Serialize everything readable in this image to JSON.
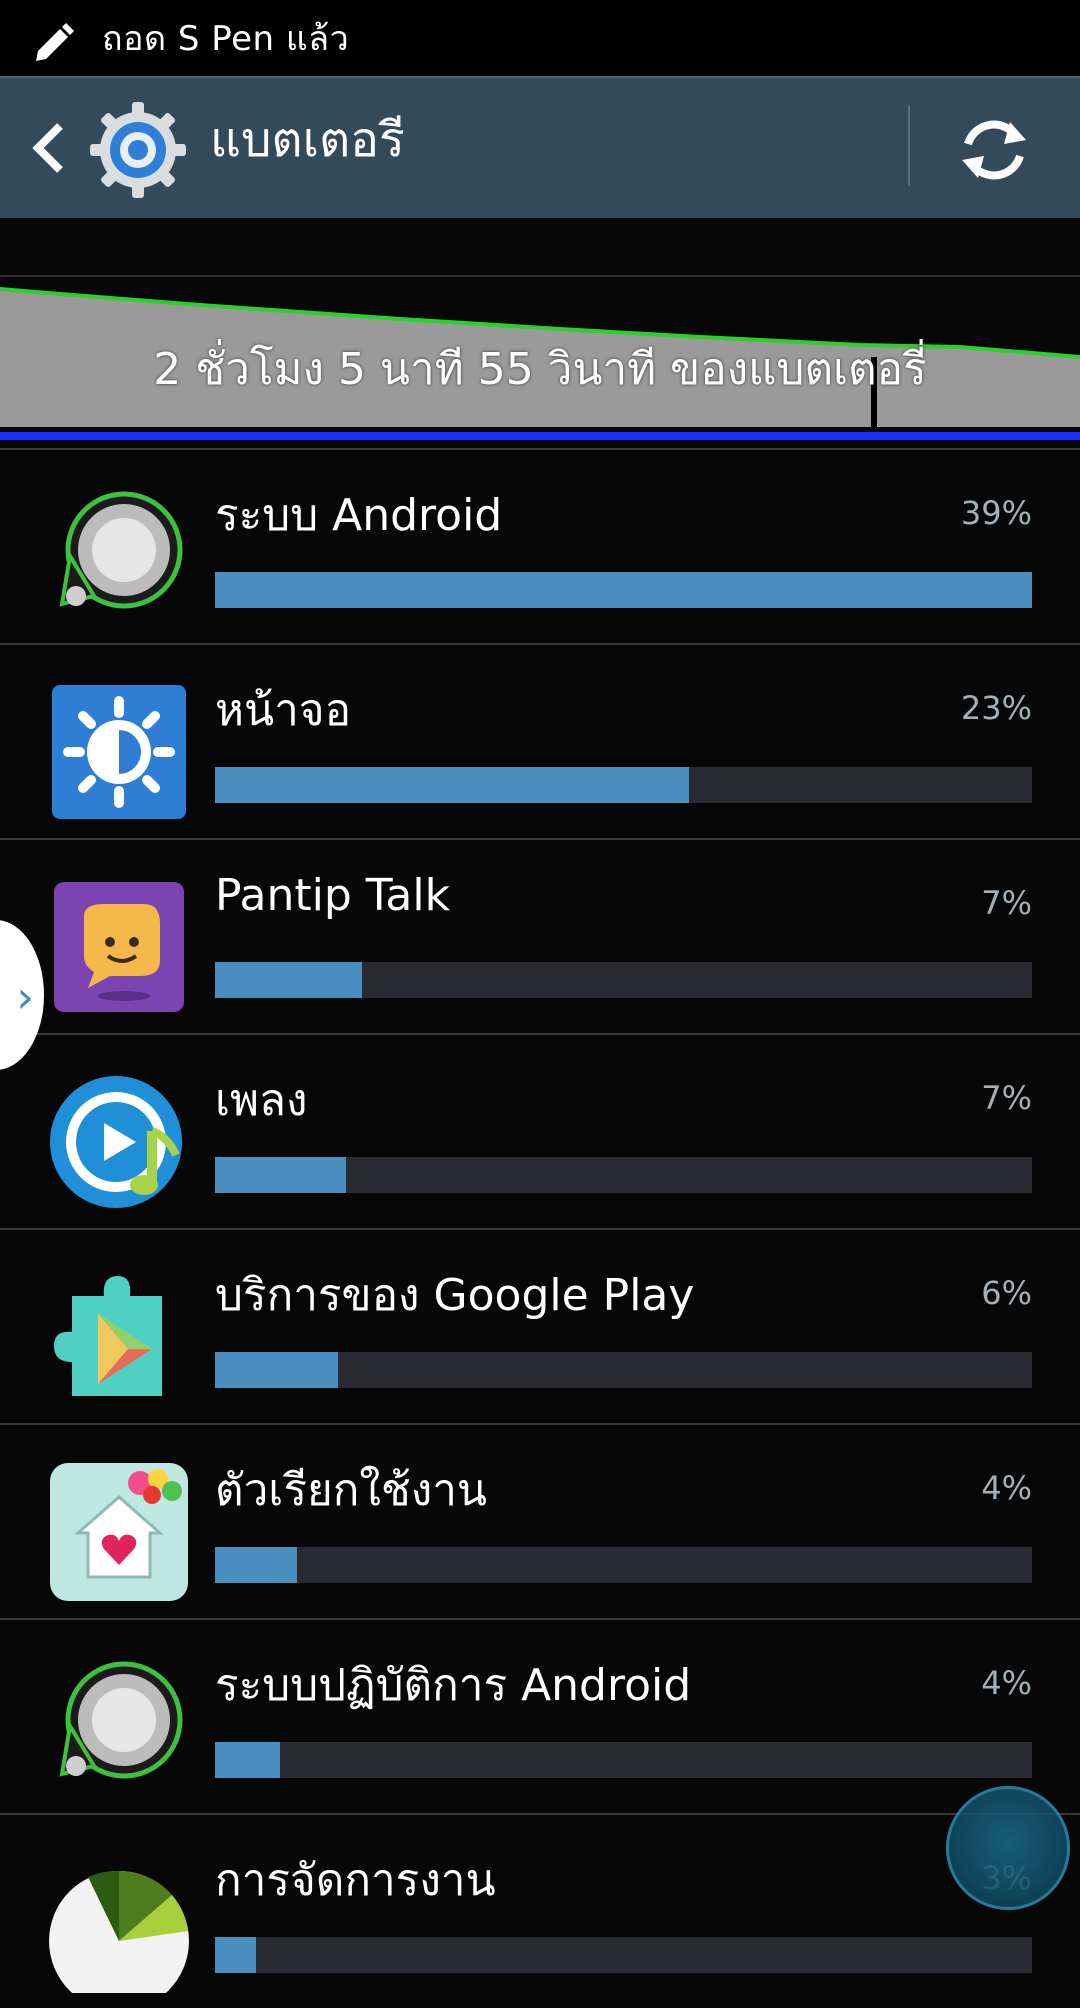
{
  "status_bar": {
    "text": "ถอด S Pen แล้ว",
    "icon": "pen-icon"
  },
  "action_bar": {
    "title": "แบตเตอรี",
    "back_icon": "back-chevron-icon",
    "app_icon": "settings-gear-icon",
    "refresh_icon": "refresh-icon"
  },
  "battery_graph": {
    "label": "2 ชั่วโมง 5 นาที 55 วินาที ของแบตเตอรี่"
  },
  "usage": [
    {
      "name": "ระบบ Android",
      "percent_label": "39%",
      "bar_fraction": 1.0,
      "icon": "android-system-icon"
    },
    {
      "name": "หน้าจอ",
      "percent_label": "23%",
      "bar_fraction": 0.58,
      "icon": "screen-brightness-icon"
    },
    {
      "name": "Pantip Talk",
      "percent_label": "7%",
      "bar_fraction": 0.18,
      "icon": "pantip-talk-icon"
    },
    {
      "name": "เพลง",
      "percent_label": "7%",
      "bar_fraction": 0.16,
      "icon": "music-player-icon"
    },
    {
      "name": "บริการของ Google Play",
      "percent_label": "6%",
      "bar_fraction": 0.15,
      "icon": "google-play-services-icon"
    },
    {
      "name": "ตัวเรียกใช้งาน",
      "percent_label": "4%",
      "bar_fraction": 0.1,
      "icon": "launcher-icon"
    },
    {
      "name": "ระบบปฏิบัติการ Android",
      "percent_label": "4%",
      "bar_fraction": 0.08,
      "icon": "android-os-icon"
    },
    {
      "name": "การจัดการงาน",
      "percent_label": "3%",
      "bar_fraction": 0.05,
      "icon": "task-manager-icon"
    }
  ],
  "colors": {
    "bar_fill": "#4a8ec0",
    "action_bar": "#334a5b",
    "graph_line": "#2bd12b"
  }
}
